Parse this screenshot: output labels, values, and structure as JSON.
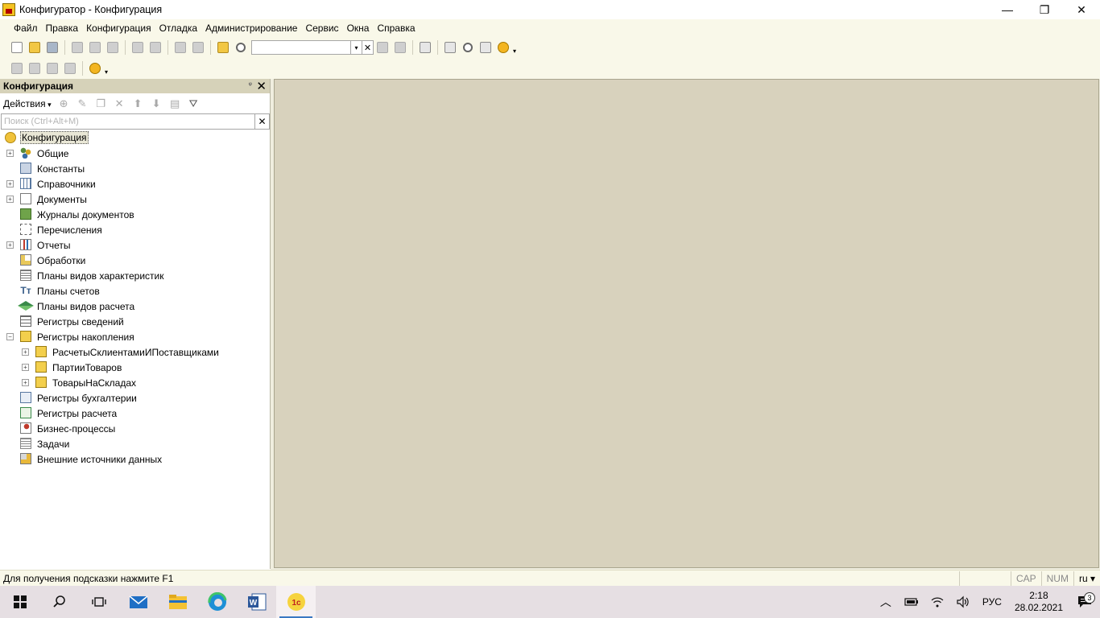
{
  "window": {
    "title": "Конфигуратор - Конфигурация",
    "controls": {
      "minimize": "—",
      "restore": "❐",
      "close": "✕"
    }
  },
  "menu": [
    {
      "label": "Файл"
    },
    {
      "label": "Правка"
    },
    {
      "label": "Конфигурация"
    },
    {
      "label": "Отладка"
    },
    {
      "label": "Администрирование"
    },
    {
      "label": "Сервис"
    },
    {
      "label": "Окна"
    },
    {
      "label": "Справка"
    }
  ],
  "toolbar": {
    "search_value": "",
    "dropdown_glyph": "▾",
    "clear_glyph": "✕",
    "more_glyph": "▾"
  },
  "panel": {
    "title": "Конфигурация",
    "pin_glyph": "ᵠ",
    "close_glyph": "✕",
    "actions_label": "Действия",
    "search_placeholder": "Поиск (Ctrl+Alt+M)",
    "search_clear": "✕"
  },
  "tree": {
    "root": "Конфигурация",
    "items": [
      {
        "label": "Общие",
        "expand": "+",
        "icon": "common-icon"
      },
      {
        "label": "Константы",
        "expand": "",
        "icon": "constants-icon"
      },
      {
        "label": "Справочники",
        "expand": "+",
        "icon": "catalogs-icon"
      },
      {
        "label": "Документы",
        "expand": "+",
        "icon": "documents-icon"
      },
      {
        "label": "Журналы документов",
        "expand": "",
        "icon": "journals-icon"
      },
      {
        "label": "Перечисления",
        "expand": "",
        "icon": "enums-icon"
      },
      {
        "label": "Отчеты",
        "expand": "+",
        "icon": "reports-icon"
      },
      {
        "label": "Обработки",
        "expand": "",
        "icon": "processings-icon"
      },
      {
        "label": "Планы видов характеристик",
        "expand": "",
        "icon": "chart-of-characteristics-icon"
      },
      {
        "label": "Планы счетов",
        "expand": "",
        "icon": "chart-of-accounts-icon"
      },
      {
        "label": "Планы видов расчета",
        "expand": "",
        "icon": "chart-of-calculation-types-icon"
      },
      {
        "label": "Регистры сведений",
        "expand": "",
        "icon": "information-registers-icon"
      },
      {
        "label": "Регистры накопления",
        "expand": "−",
        "icon": "accumulation-registers-icon"
      },
      {
        "label": "РасчетыСклиентамиИПоставщиками",
        "expand": "+",
        "icon": "accumulation-register-icon",
        "level": 1
      },
      {
        "label": "ПартииТоваров",
        "expand": "+",
        "icon": "accumulation-register-icon",
        "level": 1
      },
      {
        "label": "ТоварыНаСкладах",
        "expand": "+",
        "icon": "accumulation-register-icon",
        "level": 1
      },
      {
        "label": "Регистры бухгалтерии",
        "expand": "",
        "icon": "accounting-registers-icon"
      },
      {
        "label": "Регистры расчета",
        "expand": "",
        "icon": "calculation-registers-icon"
      },
      {
        "label": "Бизнес-процессы",
        "expand": "",
        "icon": "business-processes-icon"
      },
      {
        "label": "Задачи",
        "expand": "",
        "icon": "tasks-icon"
      },
      {
        "label": "Внешние источники данных",
        "expand": "",
        "icon": "external-data-sources-icon"
      }
    ]
  },
  "status": {
    "hint": "Для получения подсказки нажмите F1",
    "cap": "CAP",
    "num": "NUM",
    "lang": "ru ▾"
  },
  "taskbar": {
    "tray_lang": "РУС",
    "time": "2:18",
    "date": "28.02.2021",
    "notifications": "3"
  }
}
